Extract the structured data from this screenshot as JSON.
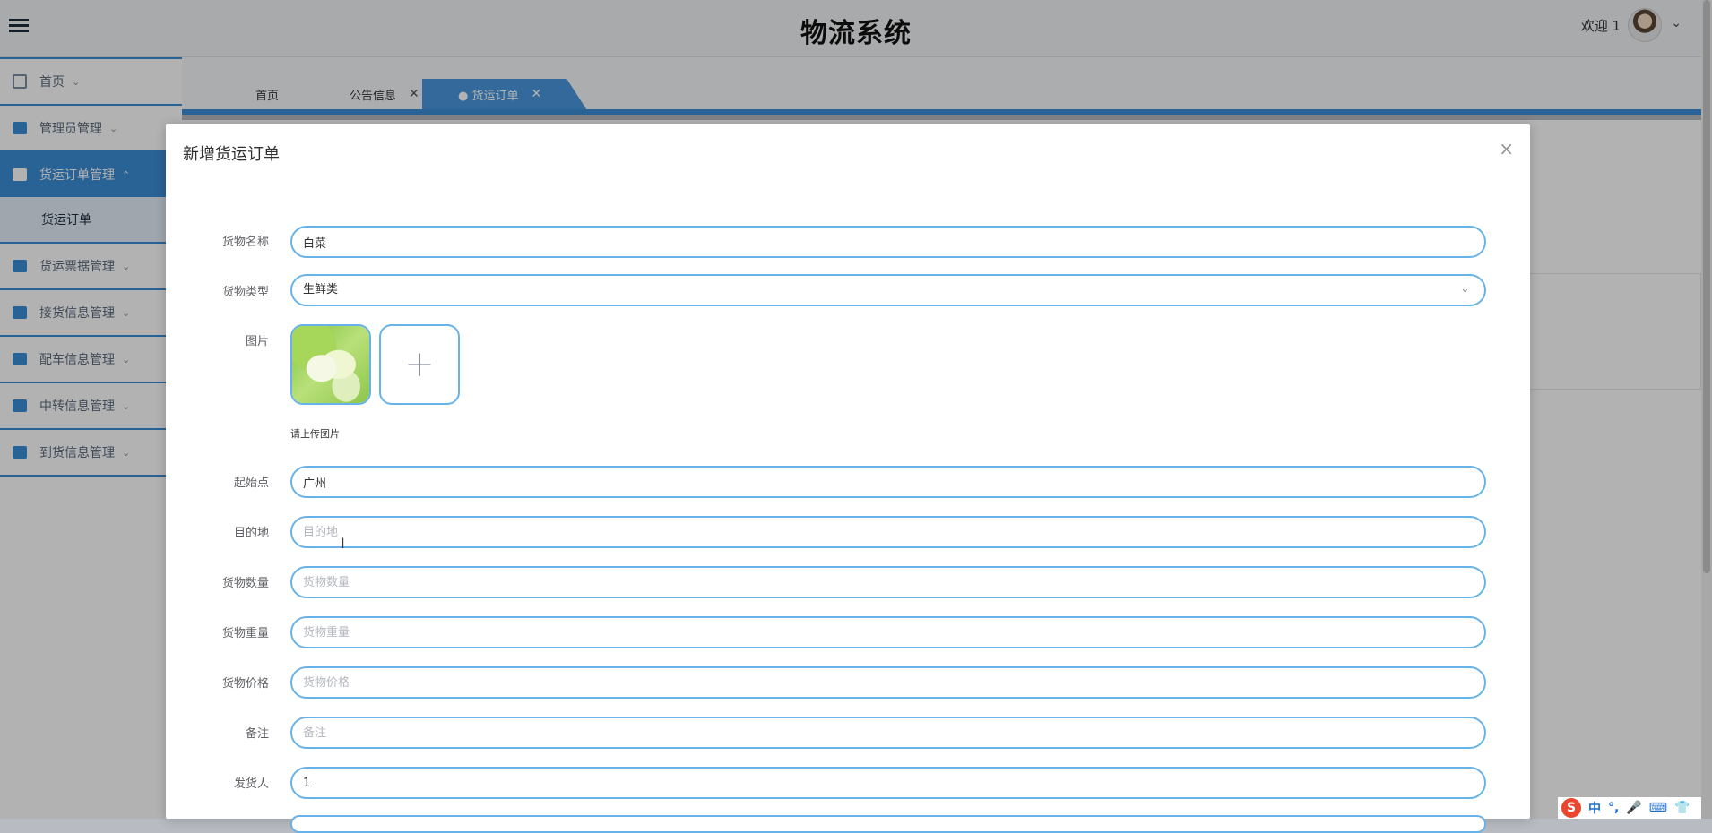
{
  "app": {
    "title": "物流系统",
    "welcome": "欢迎 1",
    "accent": "#3b8dd6"
  },
  "sidebar": {
    "items": [
      {
        "label": "首页",
        "icon": "home-icon"
      },
      {
        "label": "管理员管理",
        "icon": "admin-icon"
      },
      {
        "label": "货运订单管理",
        "icon": "order-icon"
      },
      {
        "label": "货运票据管理",
        "icon": "ticket-icon"
      },
      {
        "label": "接货信息管理",
        "icon": "pickup-icon"
      },
      {
        "label": "配车信息管理",
        "icon": "vehicle-icon"
      },
      {
        "label": "中转信息管理",
        "icon": "transfer-icon"
      },
      {
        "label": "到货信息管理",
        "icon": "arrival-icon"
      }
    ],
    "sub_item": "货运订单"
  },
  "tabs": [
    {
      "label": "首页"
    },
    {
      "label": "公告信息"
    },
    {
      "label": "● 货运订单"
    }
  ],
  "modal": {
    "title": "新增货运订单",
    "close": "×",
    "fields": {
      "name": {
        "label": "货物名称",
        "value": "白菜"
      },
      "type": {
        "label": "货物类型",
        "value": "生鲜类"
      },
      "image": {
        "label": "图片",
        "tip": "请上传图片"
      },
      "origin": {
        "label": "起始点",
        "value": "广州"
      },
      "destination": {
        "label": "目的地",
        "placeholder": "目的地"
      },
      "quantity": {
        "label": "货物数量",
        "placeholder": "货物数量"
      },
      "weight": {
        "label": "货物重量",
        "placeholder": "货物重量"
      },
      "price": {
        "label": "货物价格",
        "placeholder": "货物价格"
      },
      "remark": {
        "label": "备注",
        "placeholder": "备注"
      },
      "shipper": {
        "label": "发货人",
        "value": "1"
      }
    }
  },
  "ime": {
    "mode": "中",
    "punct": "°,"
  }
}
